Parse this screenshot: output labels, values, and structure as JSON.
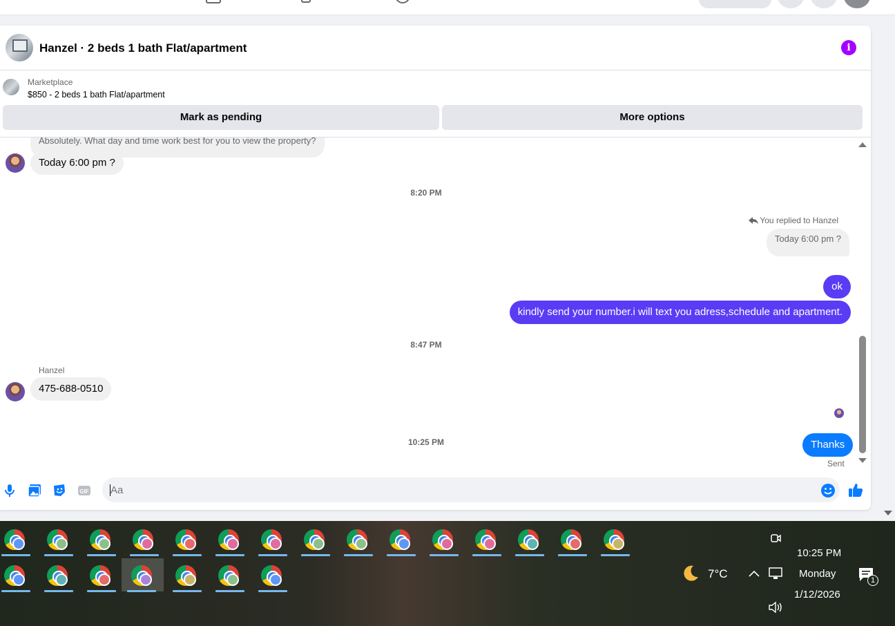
{
  "conversation": {
    "title": "Hanzel · 2 beds 1 bath Flat/apartment"
  },
  "listing": {
    "label": "Marketplace",
    "title": "$850 - 2 beds 1 bath Flat/apartment",
    "mark_pending": "Mark as pending",
    "more_options": "More options"
  },
  "messages": {
    "prev_quote": "Absolutely. What day and time work best for you to view the property?",
    "msg1": "Today 6:00 pm ?",
    "ts1": "8:20 PM",
    "replied_label": "You replied to Hanzel",
    "quoted": "Today 6:00 pm ?",
    "msg_ok": "ok",
    "msg_number": "kindly send your number.i will text you adress,schedule and apartment.",
    "ts2": "8:47 PM",
    "sender": "Hanzel",
    "msg_phone": "475-688-0510",
    "ts3": "10:25 PM",
    "msg_thanks": "Thanks",
    "sent_status": "Sent"
  },
  "composer": {
    "placeholder": "Aa"
  },
  "taskbar": {
    "temperature": "7°C",
    "time": "10:25 PM",
    "day": "Monday",
    "date": "1/12/2026",
    "notification_count": "1"
  },
  "colors": {
    "accent_purple": "#5b3cf5",
    "accent_blue": "#0a7cff",
    "info_purple": "#a400ff"
  }
}
